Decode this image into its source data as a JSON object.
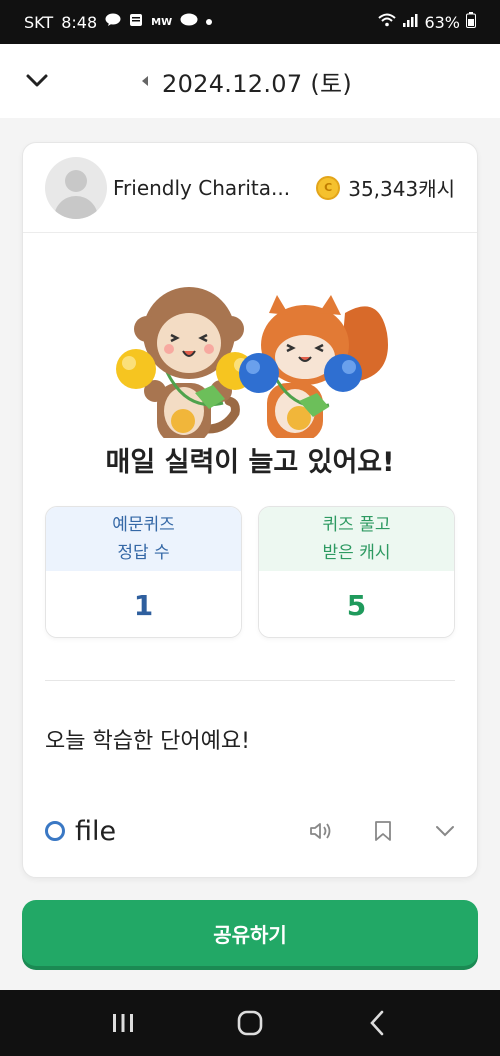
{
  "status_bar": {
    "carrier": "SKT",
    "time": "8:48",
    "battery": "63%",
    "notification_icons": [
      "talk-icon",
      "news-icon",
      "mw-icon",
      "chat-icon"
    ]
  },
  "header": {
    "date": "2024.12.07 (토)"
  },
  "profile": {
    "name": "Friendly Charita...",
    "cash": "35,343캐시",
    "coin_symbol": "C"
  },
  "headline": "매일 실력이 늘고 있어요!",
  "stats": {
    "quiz": {
      "label_line1": "예문퀴즈",
      "label_line2": "정답 수",
      "value": "1"
    },
    "cash": {
      "label_line1": "퀴즈 풀고",
      "label_line2": "받은 캐시",
      "value": "5"
    }
  },
  "section_title": "오늘 학습한 단어예요!",
  "word": {
    "text": "file"
  },
  "share_button": "공유하기",
  "colors": {
    "accent_green": "#22a866",
    "accent_blue": "#3a78c4",
    "coin": "#f5c12e"
  },
  "icons": [
    "chevron-down-icon",
    "caret-left-icon",
    "coin-icon",
    "speaker-icon",
    "bookmark-icon",
    "expand-icon",
    "recent-apps-icon",
    "home-icon",
    "back-icon"
  ]
}
